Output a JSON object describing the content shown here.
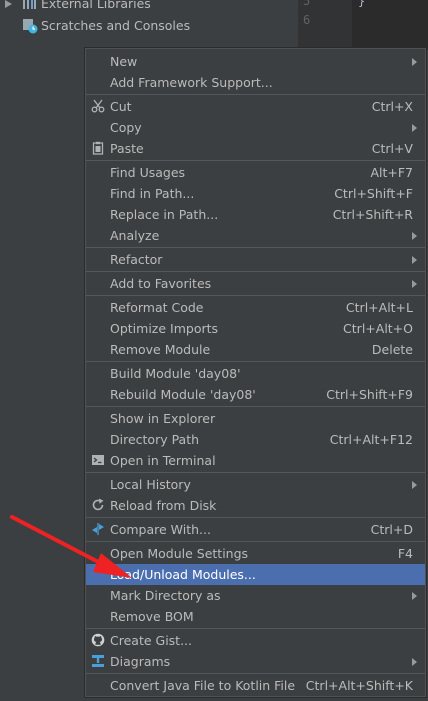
{
  "tree": {
    "external_libraries": "External Libraries",
    "scratches": "Scratches and Consoles"
  },
  "editor": {
    "line5": "5",
    "line6": "6",
    "brace": "}"
  },
  "menu": {
    "new": "New",
    "add_framework": "Add Framework Support...",
    "cut": "Cut",
    "cut_sc": "Ctrl+X",
    "copy": "Copy",
    "paste": "Paste",
    "paste_sc": "Ctrl+V",
    "find_usages": "Find Usages",
    "find_usages_sc": "Alt+F7",
    "find_in_path": "Find in Path...",
    "find_in_path_sc": "Ctrl+Shift+F",
    "replace_in_path": "Replace in Path...",
    "replace_in_path_sc": "Ctrl+Shift+R",
    "analyze": "Analyze",
    "refactor": "Refactor",
    "add_favorites": "Add to Favorites",
    "reformat": "Reformat Code",
    "reformat_sc": "Ctrl+Alt+L",
    "optimize": "Optimize Imports",
    "optimize_sc": "Ctrl+Alt+O",
    "remove_module": "Remove Module",
    "remove_module_sc": "Delete",
    "build_module": "Build Module 'day08'",
    "rebuild_module": "Rebuild Module 'day08'",
    "rebuild_module_sc": "Ctrl+Shift+F9",
    "show_explorer": "Show in Explorer",
    "directory_path": "Directory Path",
    "directory_path_sc": "Ctrl+Alt+F12",
    "open_terminal": "Open in Terminal",
    "local_history": "Local History",
    "reload_disk": "Reload from Disk",
    "compare_with": "Compare With...",
    "compare_with_sc": "Ctrl+D",
    "open_module_settings": "Open Module Settings",
    "open_module_settings_sc": "F4",
    "load_unload": "Load/Unload Modules...",
    "mark_directory": "Mark Directory as",
    "remove_bom": "Remove BOM",
    "create_gist": "Create Gist...",
    "diagrams": "Diagrams",
    "convert_kotlin": "Convert Java File to Kotlin File",
    "convert_kotlin_sc": "Ctrl+Alt+Shift+K"
  },
  "colors": {
    "selection": "#4b6eaf",
    "annotation_arrow": "#ee2222"
  }
}
